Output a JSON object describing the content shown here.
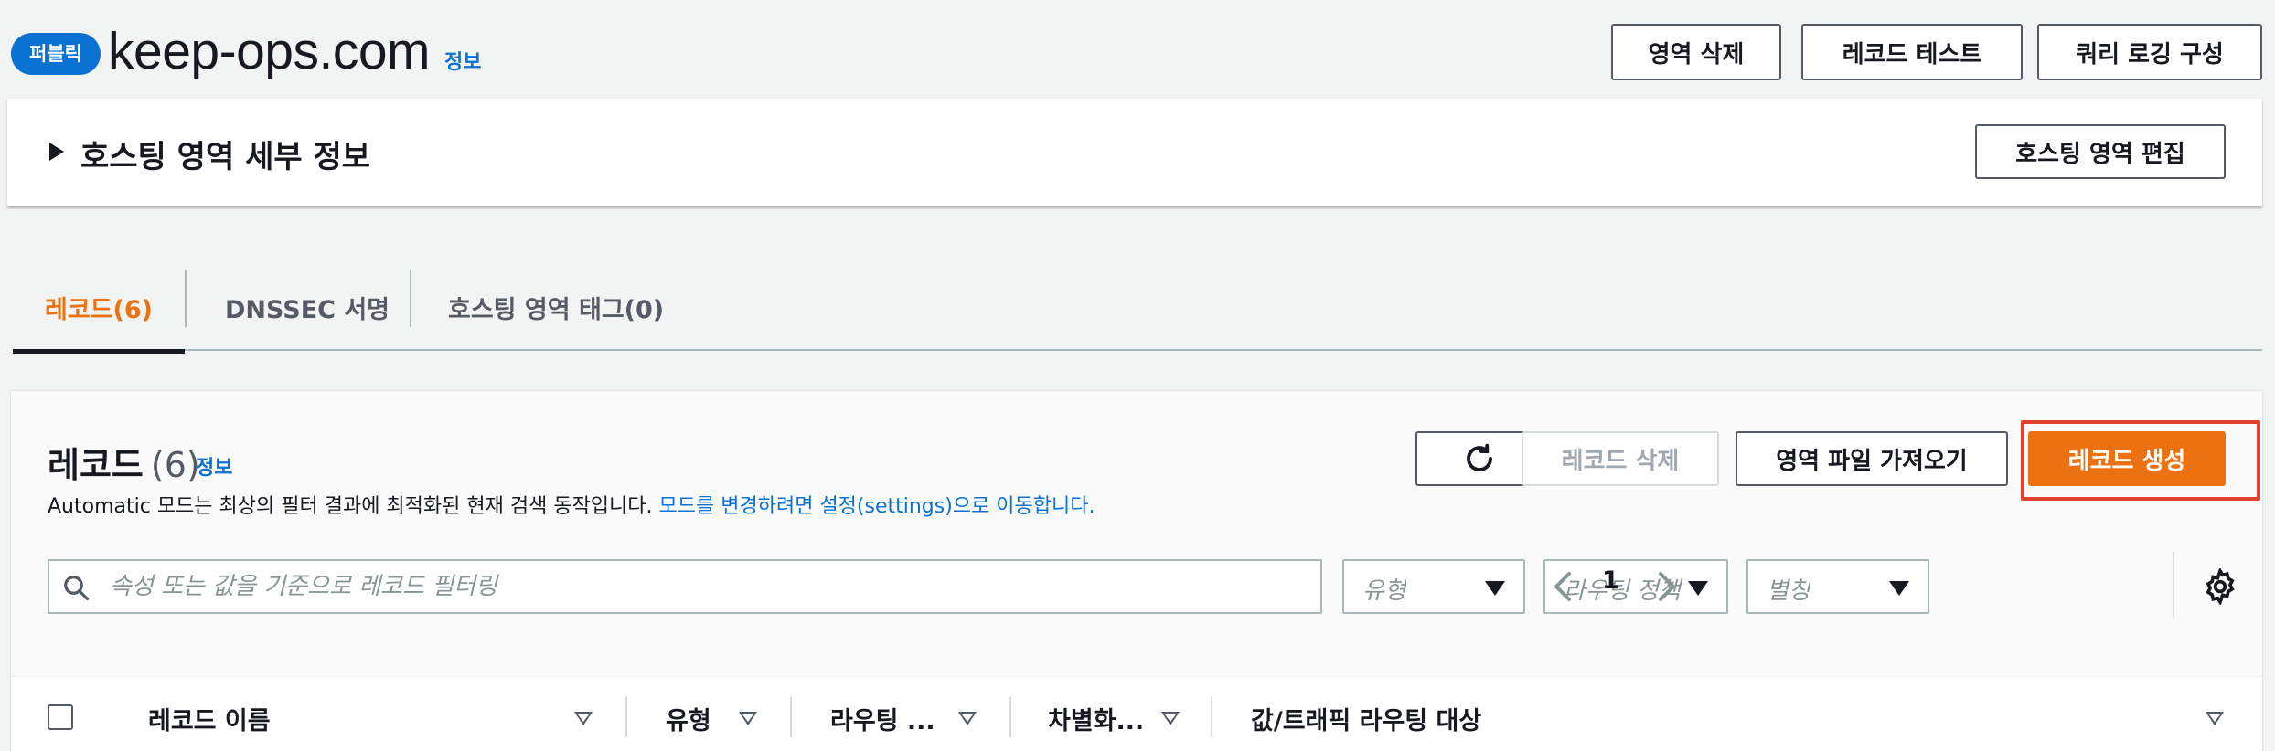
{
  "header": {
    "badge": "퍼블릭",
    "zone_name": "keep-ops.com",
    "info_link": "정보",
    "buttons": {
      "delete_zone": "영역 삭제",
      "test_record": "레코드 테스트",
      "query_logging": "쿼리 로깅 구성"
    }
  },
  "details": {
    "title": "호스팅 영역 세부 정보",
    "edit_button": "호스팅 영역 편집"
  },
  "tabs": [
    {
      "label": "레코드(6)",
      "active": true
    },
    {
      "label": "DNSSEC 서명",
      "active": false
    },
    {
      "label": "호스팅 영역 태그(0)",
      "active": false
    }
  ],
  "records": {
    "title": "레코드",
    "count": "(6)",
    "info_link": "정보",
    "description": "Automatic 모드는 최상의 필터 결과에 최적화된 현재 검색 동작입니다.",
    "description_link": "모드를 변경하려면 설정(settings)으로 이동합니다.",
    "buttons": {
      "delete_record": "레코드 삭제",
      "import_zone_file": "영역 파일 가져오기",
      "create_record": "레코드 생성"
    },
    "search_placeholder": "속성 또는 값을 기준으로 레코드 필터링",
    "filters": {
      "type": "유형",
      "routing_policy": "라우팅 정책",
      "alias": "별칭"
    },
    "pagination": {
      "current_page": "1"
    },
    "columns": [
      "레코드 이름",
      "유형",
      "라우팅 ...",
      "차별화...",
      "값/트래픽 라우팅 대상"
    ]
  },
  "colors": {
    "accent_orange": "#ec7211",
    "link_blue": "#0972d3",
    "highlight_red": "#e2412d"
  }
}
